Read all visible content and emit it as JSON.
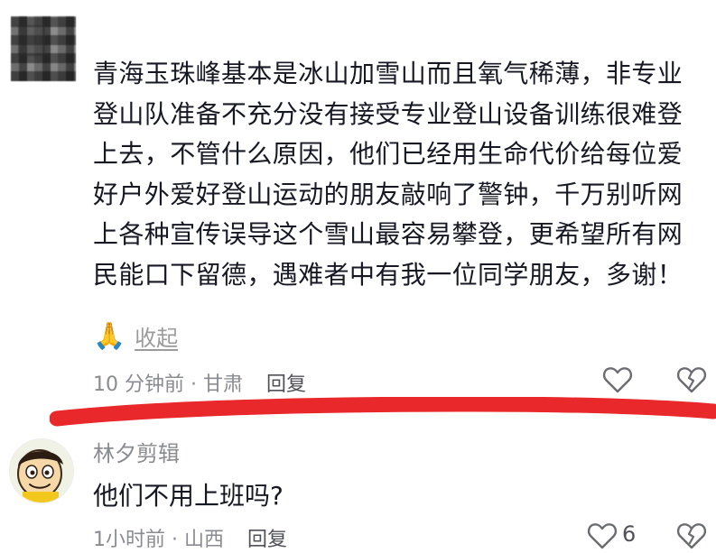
{
  "comment1": {
    "lines": [
      "青海玉珠峰基本是冰山加雪山而且氧气稀薄，非专业",
      "登山队准备不充分没有接受专业登山设备训练很难登",
      "上去，不管什么原因，他们已经用生命代价给每位爱",
      "好户外爱好登山运动的朋友敲响了警钟，千万别听网",
      "上各种宣传误导这个雪山最容易攀登，更希望所有网",
      "民能口下留德，遇难者中有我一位同学朋友，多谢！"
    ],
    "emoji": "🙏",
    "collapse_label": "收起",
    "time_location": "10 分钟前 · 甘肃",
    "reply_label": "回复"
  },
  "comment2": {
    "username": "林夕剪辑",
    "text": "他们不用上班吗?",
    "time_location": "1小时前 · 山西",
    "reply_label": "回复",
    "like_count": "6"
  },
  "icons": {
    "like": "heart-outline-icon",
    "dislike": "broken-heart-icon"
  },
  "colors": {
    "highlight_stroke": "#e8282b",
    "secondary_text": "#8a8b91",
    "icon_stroke": "#6b6c72"
  }
}
